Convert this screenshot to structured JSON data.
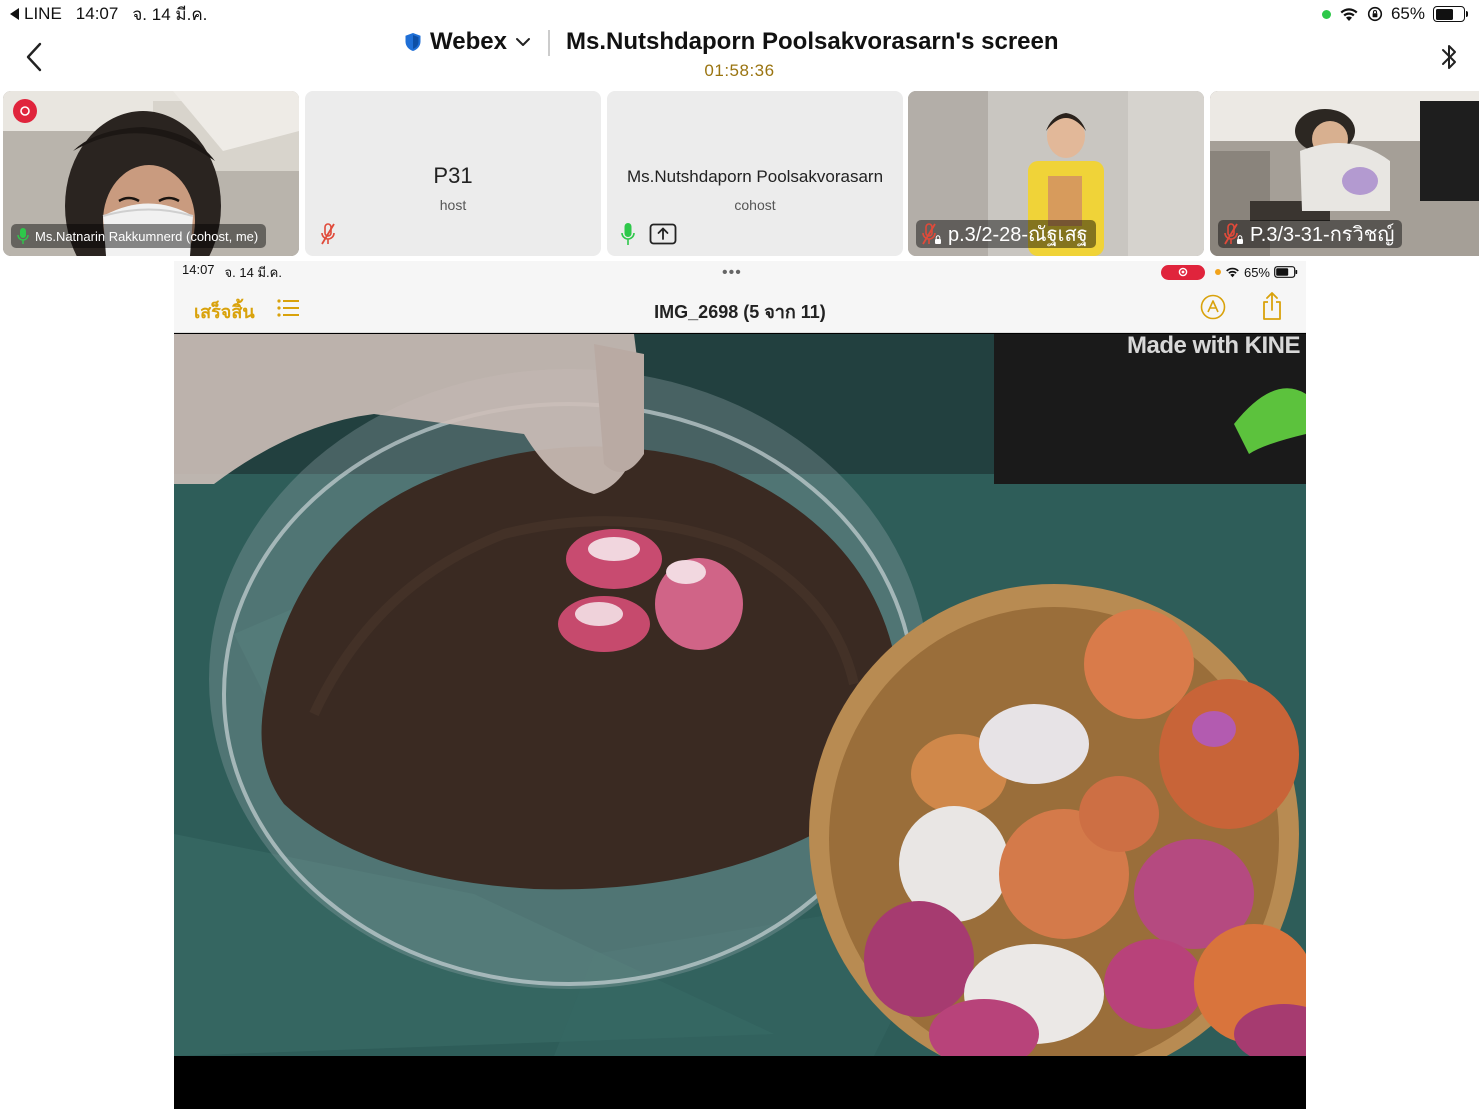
{
  "status_bar": {
    "back_app": "LINE",
    "time": "14:07",
    "date": "จ. 14 มี.ค.",
    "battery_text": "65%",
    "battery_level": 0.65
  },
  "header": {
    "app_name": "Webex",
    "screen_title": "Ms.Nutshdaporn Poolsakvorasarn's screen",
    "timer": "01:58:36"
  },
  "participants": [
    {
      "name": "Ms.Natnarin Rakkumnerd (cohost, me)",
      "type": "video"
    },
    {
      "name": "P31",
      "role": "host",
      "type": "avatar"
    },
    {
      "name": "Ms.Nutshdaporn Poolsakvorasarn",
      "role": "cohost",
      "type": "avatar"
    },
    {
      "name": "p.3/2-28-ณัฐเสฐ",
      "type": "video"
    },
    {
      "name": "P.3/3-31-กรวิชญ์",
      "type": "video"
    }
  ],
  "shared": {
    "status_time": "14:07",
    "status_date": "จ. 14 มี.ค.",
    "status_battery": "65%",
    "done_label": "เสร็จสิ้น",
    "photo_title": "IMG_2698 (5 จาก 11)",
    "watermark": "Made with KINE"
  },
  "colors": {
    "accent_yellow": "#d9a20b",
    "timer_gold": "#9a7410",
    "record_red": "#e0243c",
    "mic_green": "#2ec84a",
    "muted_red": "#e04a3a"
  }
}
